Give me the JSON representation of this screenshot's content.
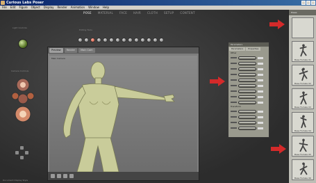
{
  "window": {
    "title": "Curious Labs Poser"
  },
  "menu": [
    "File",
    "Edit",
    "Figure",
    "Object",
    "Display",
    "Render",
    "Animation",
    "Window",
    "Help"
  ],
  "rooms": [
    {
      "label": "POSE",
      "active": true
    },
    {
      "label": "MATERIAL",
      "active": false
    },
    {
      "label": "FACE",
      "active": false
    },
    {
      "label": "HAIR",
      "active": false
    },
    {
      "label": "CLOTH",
      "active": false
    },
    {
      "label": "SETUP",
      "active": false
    },
    {
      "label": "CONTENT",
      "active": false
    }
  ],
  "left_panel": {
    "light_label": "Light Controls",
    "camera_label": "Camera Controls",
    "bottom_label": "Document Display Style"
  },
  "toolbar": {
    "label": "Editing Tools",
    "count": 14,
    "active_index": 2
  },
  "document": {
    "tabs": [
      "Preview",
      "Render"
    ],
    "active_tab": "Preview",
    "viewport_label": "Main Camera",
    "sub_label": "Main Cam"
  },
  "parameters": {
    "title": "Parameters",
    "tabs": [
      "Parameters",
      "Properties"
    ],
    "groups": [
      {
        "name": "Other",
        "rows": 9
      },
      {
        "name": "Transform",
        "rows": 4
      }
    ]
  },
  "library": {
    "title": "Poses",
    "items": [
      {
        "label": ""
      },
      {
        "label": "Base Female 01"
      },
      {
        "label": "Base Female 02"
      },
      {
        "label": "Base Female 03"
      },
      {
        "label": "Base Female 04"
      },
      {
        "label": "Base Female 05"
      },
      {
        "label": "Base Female 06"
      }
    ]
  },
  "colors": {
    "arrow": "#d42a2a",
    "figure": "#c9cc9a",
    "background": "#2b2b2b",
    "active_tool": "#c0402a"
  }
}
